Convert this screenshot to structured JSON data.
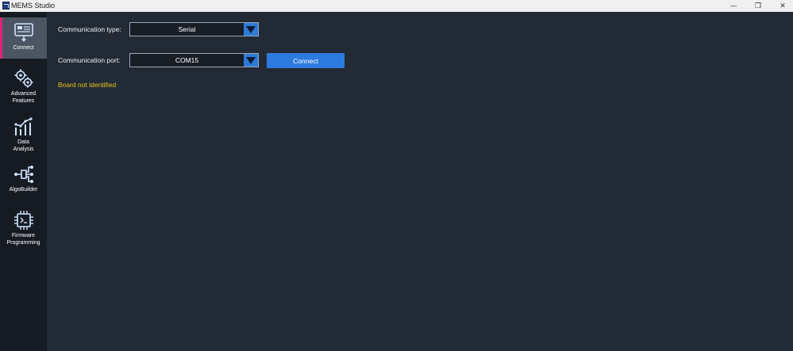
{
  "window": {
    "title": "MEMS Studio",
    "controls": {
      "minimize": "—",
      "maximize": "❐",
      "close": "✕"
    }
  },
  "sidebar": {
    "items": [
      {
        "label": "Connect",
        "icon": "connect-board-icon",
        "active": true
      },
      {
        "label": "Advanced Features",
        "icon": "gears-icon",
        "active": false
      },
      {
        "label": "Data Analysis",
        "icon": "chart-line-icon",
        "active": false
      },
      {
        "label": "AlgoBuilder",
        "icon": "flow-nodes-icon",
        "active": false
      },
      {
        "label": "Firmware Programming",
        "icon": "chip-icon",
        "active": false
      }
    ]
  },
  "main": {
    "comm_type": {
      "label": "Communication type:",
      "value": "Serial"
    },
    "comm_port": {
      "label": "Communication port:",
      "value": "COM15"
    },
    "connect_button": "Connect",
    "status": "Board not identified"
  },
  "colors": {
    "accent": "#2e7be0",
    "active_marker": "#e0247a",
    "status_warning": "#e6c61a",
    "background": "#222a36",
    "sidebar": "#161b23"
  }
}
